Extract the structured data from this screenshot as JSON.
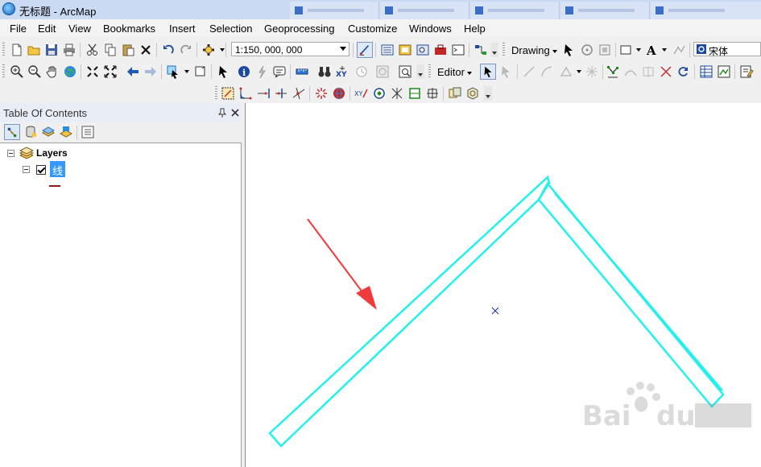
{
  "window": {
    "title": "无标题 - ArcMap"
  },
  "menu": [
    "File",
    "Edit",
    "View",
    "Bookmarks",
    "Insert",
    "Selection",
    "Geoprocessing",
    "Customize",
    "Windows",
    "Help"
  ],
  "toolbar": {
    "scale_value": "1:150, 000, 000",
    "drawing_label": "Drawing",
    "font_value": "宋体",
    "editor_label": "Editor"
  },
  "toc": {
    "title": "Table Of Contents",
    "root_label": "Layers",
    "layer_label": "线",
    "layer_checked": true,
    "symbol_color": "#8b1a1a"
  },
  "map": {
    "feature_color": "#22f0f0",
    "arrow_color": "#ef3b3b",
    "center_marker_color": "#1a2a9a"
  }
}
